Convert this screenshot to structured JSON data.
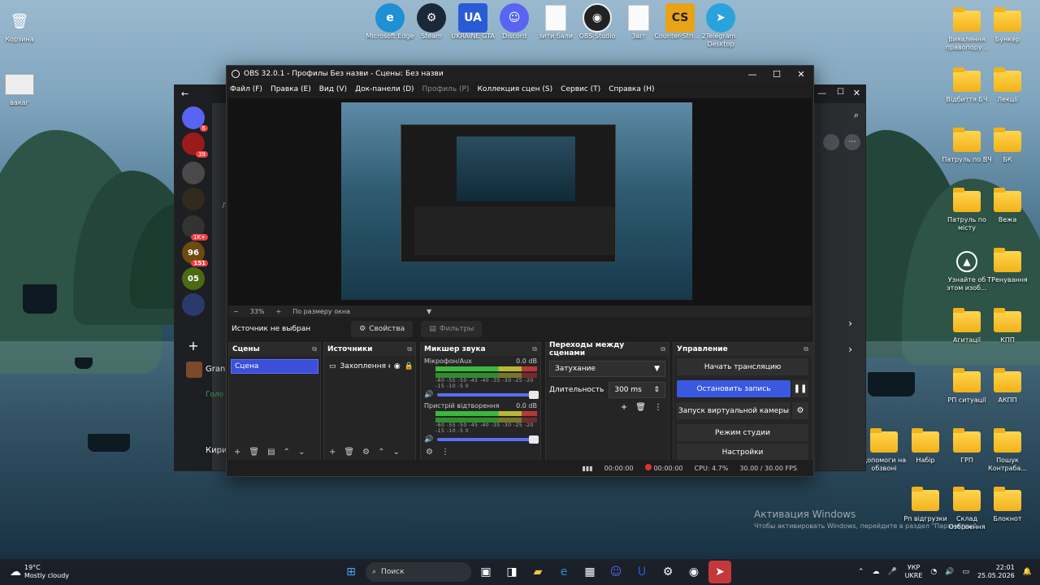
{
  "desktop_left": [
    {
      "name": "recycle-bin",
      "label": "Корзина"
    },
    {
      "name": "file-thumb",
      "label": "вакаг"
    }
  ],
  "desktop_top": [
    {
      "name": "edge",
      "label": "Microsoft Edge",
      "color": "#1f8fd6"
    },
    {
      "name": "steam",
      "label": "Steam",
      "color": "#1b2838"
    },
    {
      "name": "ukraine-gta",
      "label": "UKRAINE GTA",
      "color": "#2a5bd7"
    },
    {
      "name": "discord",
      "label": "Discord",
      "color": "#5865f2"
    },
    {
      "name": "doc-1",
      "label": "зити бали"
    },
    {
      "name": "obs",
      "label": "OBS Studio",
      "color": "#222"
    },
    {
      "name": "doc-2",
      "label": "Звіт"
    },
    {
      "name": "counter-strike",
      "label": "Counter-Stri... 2",
      "color": "#e8a317"
    },
    {
      "name": "telegram",
      "label": "Telegram Desktop",
      "color": "#2aa3dc"
    }
  ],
  "desktop_right": [
    [
      "Виявлення правопору...",
      "Бункер"
    ],
    [
      "Відбиття БЧ",
      "Лекції"
    ],
    [
      "Патруль по ВЧ",
      "БК"
    ],
    [
      "Патруль по місту",
      "Вежа"
    ],
    [
      "Узнайте об этом изоб...",
      "ТРенування"
    ],
    [
      "Агитації",
      "КПП"
    ],
    [
      "РП ситуації",
      "АКПП"
    ],
    [
      "Допомоги на обзвоні",
      "Набір",
      "ГРП",
      "Пошук Контрабa..."
    ],
    [
      "Рп відгрузки",
      "Склад Озброєння",
      "Блокнот"
    ]
  ],
  "discord_bg": {
    "badges": [
      "6",
      "39",
      "1K+",
      "151"
    ],
    "server_tags": [
      "96",
      "05"
    ],
    "partial_labels": [
      "Gran",
      "Голо",
      "Кири",
      "Л"
    ]
  },
  "obs": {
    "title": "OBS 32.0.1 - Профилы Без назви - Сцены: Без назви",
    "menu": [
      "Файл (F)",
      "Правка (E)",
      "Вид (V)",
      "Док-панели (D)",
      "Профиль (P)",
      "Коллекция сцен (S)",
      "Сервис (T)",
      "Справка (H)"
    ],
    "menu_dim_index": 4,
    "zoom": "33%",
    "fit": "По размеру окна",
    "no_source": "Источник не выбран",
    "properties_btn": "Свойства",
    "filters_btn": "Фильтры",
    "docks": {
      "scenes": {
        "title": "Сцены",
        "items": [
          "Сцена"
        ]
      },
      "sources": {
        "title": "Источники",
        "items": [
          "Захоплення екрана"
        ]
      },
      "mixer": {
        "title": "Микшер звука",
        "channels": [
          {
            "name": "Мікрофон/Aux",
            "db": "0.0 dB"
          },
          {
            "name": "Пристрій відтворення",
            "db": "0.0 dB"
          }
        ],
        "scale": "-60 -55 -50 -45 -40 -35 -30 -25 -20 -15 -10 -5 0"
      },
      "transitions": {
        "title": "Переходы между сценами",
        "type": "Затухание",
        "duration_label": "Длительность",
        "duration": "300 ms"
      },
      "controls": {
        "title": "Управление",
        "start_stream": "Начать трансляцию",
        "stop_record": "Остановить запись",
        "virtual_cam": "Запуск виртуальной камеры",
        "studio_mode": "Режим студии",
        "settings": "Настройки"
      }
    },
    "status": {
      "stream_time": "00:00:00",
      "rec_time": "00:00:00",
      "cpu": "CPU: 4.7%",
      "fps": "30.00 / 30.00 FPS"
    }
  },
  "activation": {
    "line1": "Активация Windows",
    "line2": "Чтобы активировать Windows, перейдите в раздел \"Параметры\"."
  },
  "taskbar": {
    "weather_temp": "19°C",
    "weather_desc": "Mostly cloudy",
    "search": "Поиск",
    "lang_1": "УКР",
    "lang_2": "UKRE",
    "time": "22:01",
    "date": "25.05.2026"
  }
}
